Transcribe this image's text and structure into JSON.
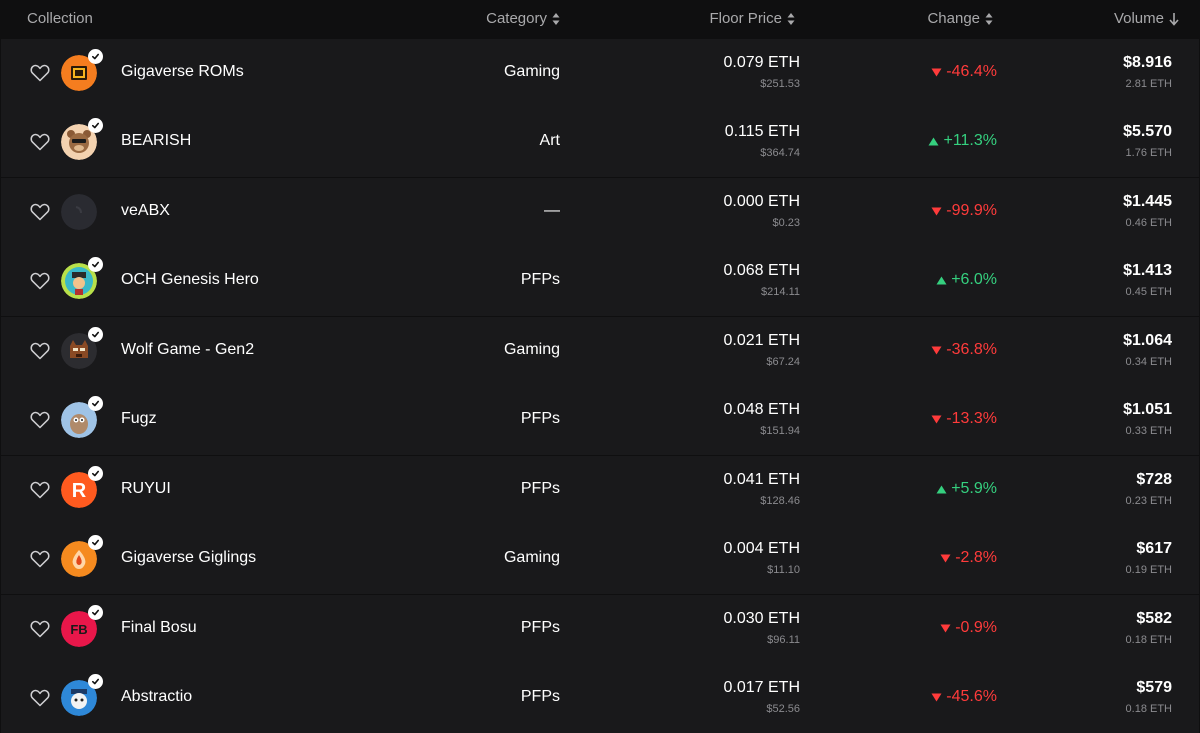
{
  "header": {
    "collection": "Collection",
    "category": "Category",
    "floor_price": "Floor Price",
    "change": "Change",
    "volume": "Volume"
  },
  "colors": {
    "down": "#ff3b3b",
    "up": "#35d07f"
  },
  "rows": [
    {
      "name": "Gigaverse ROMs",
      "category": "Gaming",
      "floor_eth": "0.079 ETH",
      "floor_usd": "$251.53",
      "change": "-46.4%",
      "direction": "down",
      "volume_usd": "$8.916",
      "volume_eth": "2.81 ETH",
      "verified": true,
      "avatar_icon": "gigaverse-rom-icon"
    },
    {
      "name": "BEARISH",
      "category": "Art",
      "floor_eth": "0.115 ETH",
      "floor_usd": "$364.74",
      "change": "+11.3%",
      "direction": "up",
      "volume_usd": "$5.570",
      "volume_eth": "1.76 ETH",
      "verified": true,
      "avatar_icon": "bear-icon"
    },
    {
      "name": "veABX",
      "category": "—",
      "floor_eth": "0.000 ETH",
      "floor_usd": "$0.23",
      "change": "-99.9%",
      "direction": "down",
      "volume_usd": "$1.445",
      "volume_eth": "0.46 ETH",
      "verified": false,
      "avatar_icon": "dark-circle-icon"
    },
    {
      "name": "OCH Genesis Hero",
      "category": "PFPs",
      "floor_eth": "0.068 ETH",
      "floor_usd": "$214.11",
      "change": "+6.0%",
      "direction": "up",
      "volume_usd": "$1.413",
      "volume_eth": "0.45 ETH",
      "verified": true,
      "avatar_icon": "pirate-hero-icon"
    },
    {
      "name": "Wolf Game - Gen2",
      "category": "Gaming",
      "floor_eth": "0.021 ETH",
      "floor_usd": "$67.24",
      "change": "-36.8%",
      "direction": "down",
      "volume_usd": "$1.064",
      "volume_eth": "0.34 ETH",
      "verified": true,
      "avatar_icon": "wolf-icon"
    },
    {
      "name": "Fugz",
      "category": "PFPs",
      "floor_eth": "0.048 ETH",
      "floor_usd": "$151.94",
      "change": "-13.3%",
      "direction": "down",
      "volume_usd": "$1.051",
      "volume_eth": "0.33 ETH",
      "verified": true,
      "avatar_icon": "fugz-icon"
    },
    {
      "name": "RUYUI",
      "category": "PFPs",
      "floor_eth": "0.041 ETH",
      "floor_usd": "$128.46",
      "change": "+5.9%",
      "direction": "up",
      "volume_usd": "$728",
      "volume_eth": "0.23 ETH",
      "verified": true,
      "avatar_icon": "ruyui-r-icon"
    },
    {
      "name": "Gigaverse Giglings",
      "category": "Gaming",
      "floor_eth": "0.004 ETH",
      "floor_usd": "$11.10",
      "change": "-2.8%",
      "direction": "down",
      "volume_usd": "$617",
      "volume_eth": "0.19 ETH",
      "verified": true,
      "avatar_icon": "gigling-egg-icon"
    },
    {
      "name": "Final Bosu",
      "category": "PFPs",
      "floor_eth": "0.030 ETH",
      "floor_usd": "$96.11",
      "change": "-0.9%",
      "direction": "down",
      "volume_usd": "$582",
      "volume_eth": "0.18 ETH",
      "verified": true,
      "avatar_icon": "fb-logo-icon"
    },
    {
      "name": "Abstractio",
      "category": "PFPs",
      "floor_eth": "0.017 ETH",
      "floor_usd": "$52.56",
      "change": "-45.6%",
      "direction": "down",
      "volume_usd": "$579",
      "volume_eth": "0.18 ETH",
      "verified": true,
      "avatar_icon": "abstractio-icon"
    }
  ],
  "row_logos": {
    "fb": "FB",
    "r": "R"
  }
}
